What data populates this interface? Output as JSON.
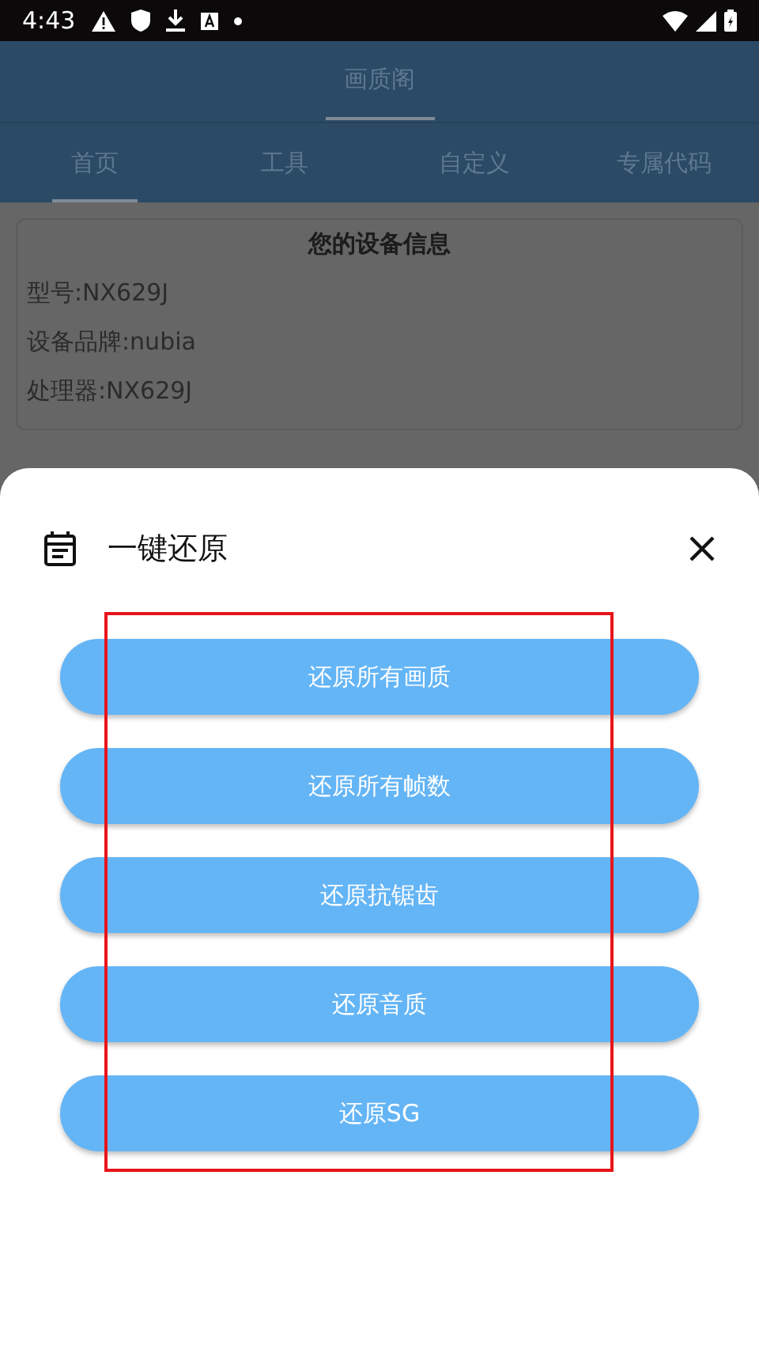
{
  "status_bar": {
    "time": "4:43"
  },
  "app_bar": {
    "title": "画质阁"
  },
  "tabs": [
    {
      "label": "首页",
      "selected": true
    },
    {
      "label": "工具",
      "selected": false
    },
    {
      "label": "自定义",
      "selected": false
    },
    {
      "label": "专属代码",
      "selected": false
    }
  ],
  "device_card": {
    "title": "您的设备信息",
    "lines": [
      "型号:NX629J",
      "设备品牌:nubia",
      "处理器:NX629J"
    ]
  },
  "sheet": {
    "title": "一键还原",
    "buttons": [
      "还原所有画质",
      "还原所有帧数",
      "还原抗锯齿",
      "还原音质",
      "还原SG"
    ]
  }
}
